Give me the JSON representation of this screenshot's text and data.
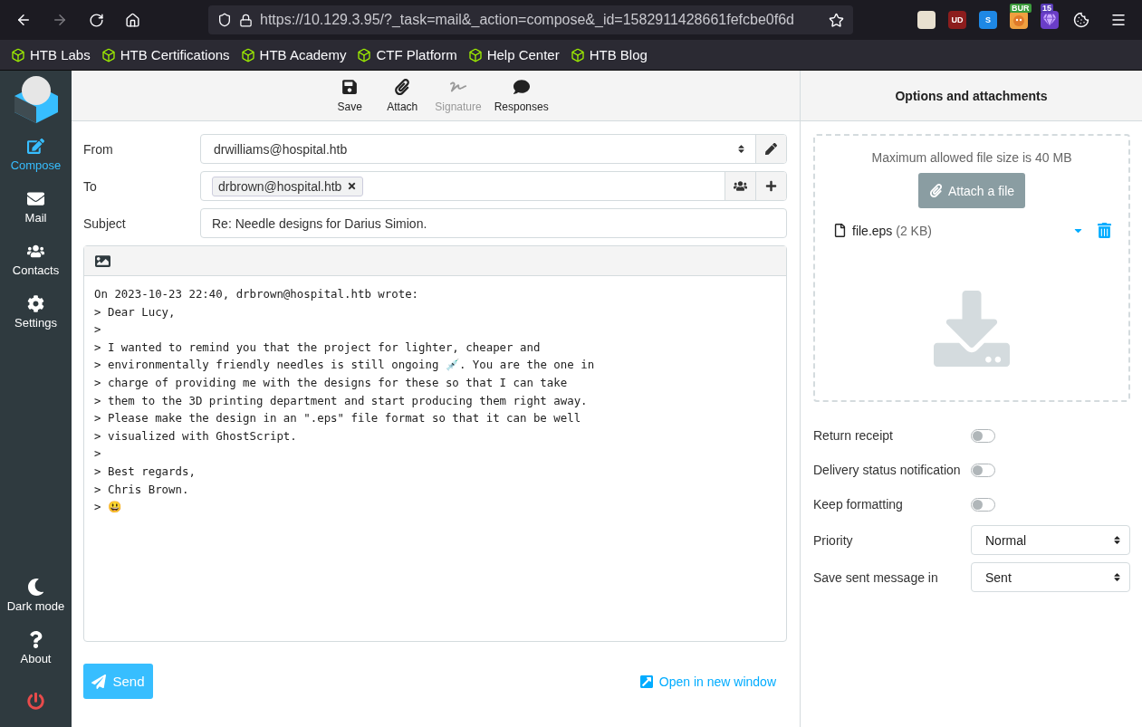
{
  "browser": {
    "url": "https://10.129.3.95/?_task=mail&_action=compose&_id=1582911428661fefcbe0f6d",
    "back_disabled": false,
    "forward_disabled": true,
    "extensions": [
      {
        "kind": "mascot"
      },
      {
        "kind": "shield",
        "badge": "UD"
      },
      {
        "kind": "square",
        "badge": "S"
      },
      {
        "kind": "burp",
        "badge": "BUR"
      },
      {
        "kind": "gem",
        "badge": "15"
      },
      {
        "kind": "cookie"
      }
    ],
    "bookmarks": [
      "HTB Labs",
      "HTB Certifications",
      "HTB Academy",
      "CTF Platform",
      "Help Center",
      "HTB Blog"
    ]
  },
  "sidebar": {
    "items": [
      {
        "kind": "compose",
        "label": "Compose",
        "selected": true
      },
      {
        "kind": "mail",
        "label": "Mail",
        "selected": false
      },
      {
        "kind": "contacts",
        "label": "Contacts",
        "selected": false
      },
      {
        "kind": "settings",
        "label": "Settings",
        "selected": false
      }
    ],
    "bottom_items": [
      {
        "kind": "dark",
        "label": "Dark mode"
      },
      {
        "kind": "about",
        "label": "About"
      },
      {
        "kind": "logout"
      }
    ]
  },
  "toolbar": [
    {
      "kind": "save",
      "label": "Save",
      "disabled": false
    },
    {
      "kind": "attach",
      "label": "Attach",
      "disabled": false
    },
    {
      "kind": "signature",
      "label": "Signature",
      "disabled": true
    },
    {
      "kind": "responses",
      "label": "Responses",
      "disabled": false
    }
  ],
  "form": {
    "from_label": "From",
    "from": "drwilliams@hospital.htb",
    "to_label": "To",
    "recipients": [
      "drbrown@hospital.htb"
    ],
    "subject_label": "Subject",
    "subject": "Re: Needle designs for Darius Simion."
  },
  "body_lines": [
    "On 2023-10-23 22:40, drbrown@hospital.htb wrote:",
    "> Dear Lucy,",
    ">",
    "> I wanted to remind you that the project for lighter, cheaper and",
    "> environmentally friendly needles is still ongoing 💉. You are the one in",
    "> charge of providing me with the designs for these so that I can take",
    "> them to the 3D printing department and start producing them right away.",
    "> Please make the design in an \".eps\" file format so that it can be well",
    "> visualized with GhostScript.",
    ">",
    "> Best regards,",
    "> Chris Brown.",
    "> 😃"
  ],
  "send_label": "Send",
  "open_window_label": "Open in new window",
  "panel": {
    "title": "Options and attachments",
    "max_size": "Maximum allowed file size is 40 MB",
    "attach_label": "Attach a file",
    "attachments": [
      {
        "name": "file.eps",
        "size": "(2 KB)"
      }
    ],
    "options": [
      {
        "kind": "toggle",
        "label": "Return receipt",
        "on": false
      },
      {
        "kind": "toggle",
        "label": "Delivery status notification",
        "on": false
      },
      {
        "kind": "toggle",
        "label": "Keep formatting",
        "on": false
      },
      {
        "kind": "select",
        "label": "Priority",
        "value": "Normal"
      },
      {
        "kind": "select",
        "label": "Save sent message in",
        "value": "Sent"
      }
    ]
  }
}
